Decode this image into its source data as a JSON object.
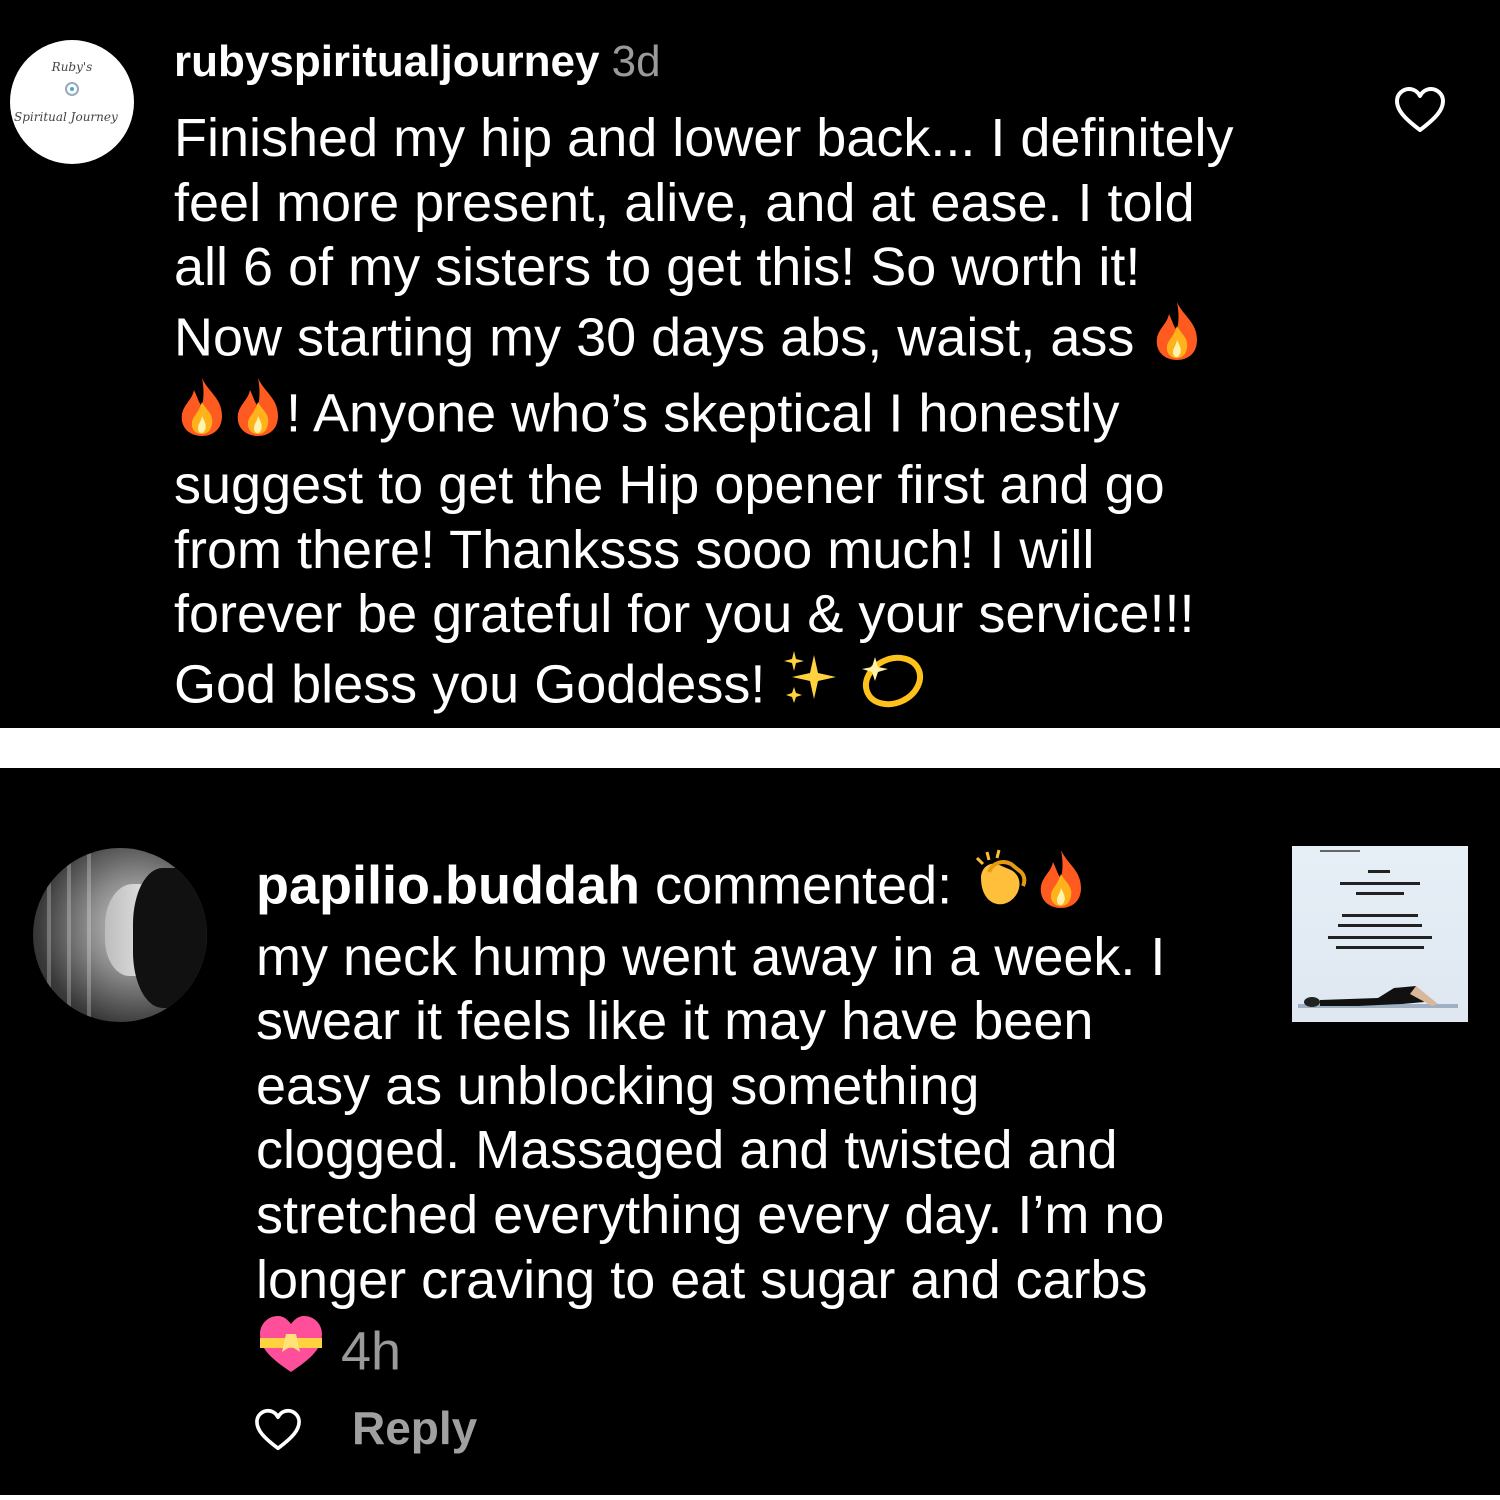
{
  "comment1": {
    "avatar_text_top": "Ruby's",
    "avatar_text_bottom": "Spiritual Journey",
    "username": "rubyspiritualjourney",
    "time": "3d",
    "text_a": "Finished my hip and lower back... I definitely\nfeel more present, alive, and at ease.  I told\nall 6 of my sisters to get this! So worth it!\nNow starting my 30 days abs, waist, ass ",
    "text_b": "! Anyone who’s skeptical I honestly\nsuggest to get the Hip opener first and go\nfrom there! Thanksss sooo much! I will\nforever be grateful for you & your service!!!\nGod bless you Goddess! ",
    "like_icon": "heart-outline-icon"
  },
  "comment2": {
    "username": "papilio.buddah",
    "verb": " commented: ",
    "text": "my neck hump went away in a week. I\nswear it feels like it may have been\neasy as unblocking something\nclogged. Massaged and twisted and\nstretched everything every day. I’m no\nlonger craving to eat sugar and carbs\n",
    "time": "4h",
    "reply_label": "Reply",
    "thumbnail_lines": [
      "POV:",
      "you're finally able to",
      "lose weight",
      "after you stop your",
      "intense workouts &",
      "you start releasing stored",
      "trauma from your body"
    ]
  },
  "colors": {
    "background": "#000000",
    "text": "#ffffff",
    "muted": "#9a9a9a",
    "separator": "#ffffff"
  }
}
